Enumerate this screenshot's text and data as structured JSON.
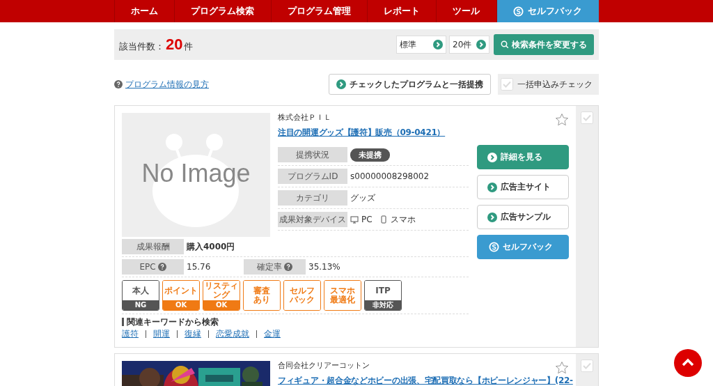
{
  "nav": [
    {
      "label": "ホーム",
      "selected": false,
      "icon": false
    },
    {
      "label": "プログラム検索",
      "selected": false,
      "icon": false
    },
    {
      "label": "プログラム管理",
      "selected": false,
      "icon": false
    },
    {
      "label": "レポート",
      "selected": false,
      "icon": false
    },
    {
      "label": "ツール",
      "selected": false,
      "icon": false
    },
    {
      "label": "セルフバック",
      "selected": true,
      "icon": true
    }
  ],
  "result_bar": {
    "label": "該当件数：",
    "count": "20",
    "unit": "件",
    "sort": "標準",
    "per_page": "20件",
    "search_button": "検索条件を変更する"
  },
  "help_link": "プログラム情報の見方",
  "bulk_button": "チェックしたプログラムと一括提携",
  "bulk_check": {
    "label": "一括申込みチェック",
    "checked": false
  },
  "programs": [
    {
      "company": "株式会社ＰＩＬ",
      "title": "注目の開運グッズ【護符】販売（09-0421）",
      "favorite": false,
      "checked": false,
      "image": {
        "kind": "placeholder",
        "text": "No Image"
      },
      "info": [
        {
          "label": "提携状況",
          "kind": "status",
          "value": "未提携"
        },
        {
          "label": "プログラムID",
          "kind": "text",
          "value": "s00000008298002"
        },
        {
          "label": "カテゴリ",
          "kind": "text",
          "value": "グッズ"
        },
        {
          "label": "成果対象デバイス",
          "kind": "devices",
          "devices": [
            {
              "kind": "pc",
              "label": "PC"
            },
            {
              "kind": "phone",
              "label": "スマホ"
            }
          ]
        }
      ],
      "reward": {
        "label": "成果報酬",
        "value": "購入4000円"
      },
      "epc": {
        "label": "EPC",
        "value": "15.76"
      },
      "rate": {
        "label": "確定率",
        "value": "35.13%"
      },
      "badges": [
        {
          "kind": "split",
          "color": "#555555",
          "top": [
            "本人"
          ],
          "bottom": "NG"
        },
        {
          "kind": "split",
          "color": "#f07a14",
          "top": [
            "ポイント"
          ],
          "bottom": "OK"
        },
        {
          "kind": "split",
          "color": "#f07a14",
          "top": [
            "リスティ",
            "ング"
          ],
          "bottom": "OK"
        },
        {
          "kind": "outline",
          "color": "#f07a14",
          "top": [
            "審査",
            "あり"
          ]
        },
        {
          "kind": "outline",
          "color": "#f07a14",
          "top": [
            "セルフ",
            "バック"
          ]
        },
        {
          "kind": "outline",
          "color": "#f07a14",
          "top": [
            "スマホ",
            "最適化"
          ]
        },
        {
          "kind": "split",
          "color": "#555555",
          "top": [
            "ITP"
          ],
          "bottom": "非対応"
        }
      ],
      "keywords_title": "関連キーワードから検索",
      "keywords": [
        "護符",
        "開運",
        "復縁",
        "恋愛成就",
        "金運"
      ],
      "buttons": [
        {
          "kind": "primary",
          "label": "詳細を見る"
        },
        {
          "kind": "plain",
          "label": "広告主サイト"
        },
        {
          "kind": "plain",
          "label": "広告サンプル"
        },
        {
          "kind": "selfback",
          "label": "セルフバック"
        }
      ]
    },
    {
      "company": "合同会社クリアーコットン",
      "title": "フィギュア・超合金などホビーの出張、宅配買取なら【ホビーレンジャー】(22-",
      "favorite": false,
      "checked": false
    }
  ]
}
